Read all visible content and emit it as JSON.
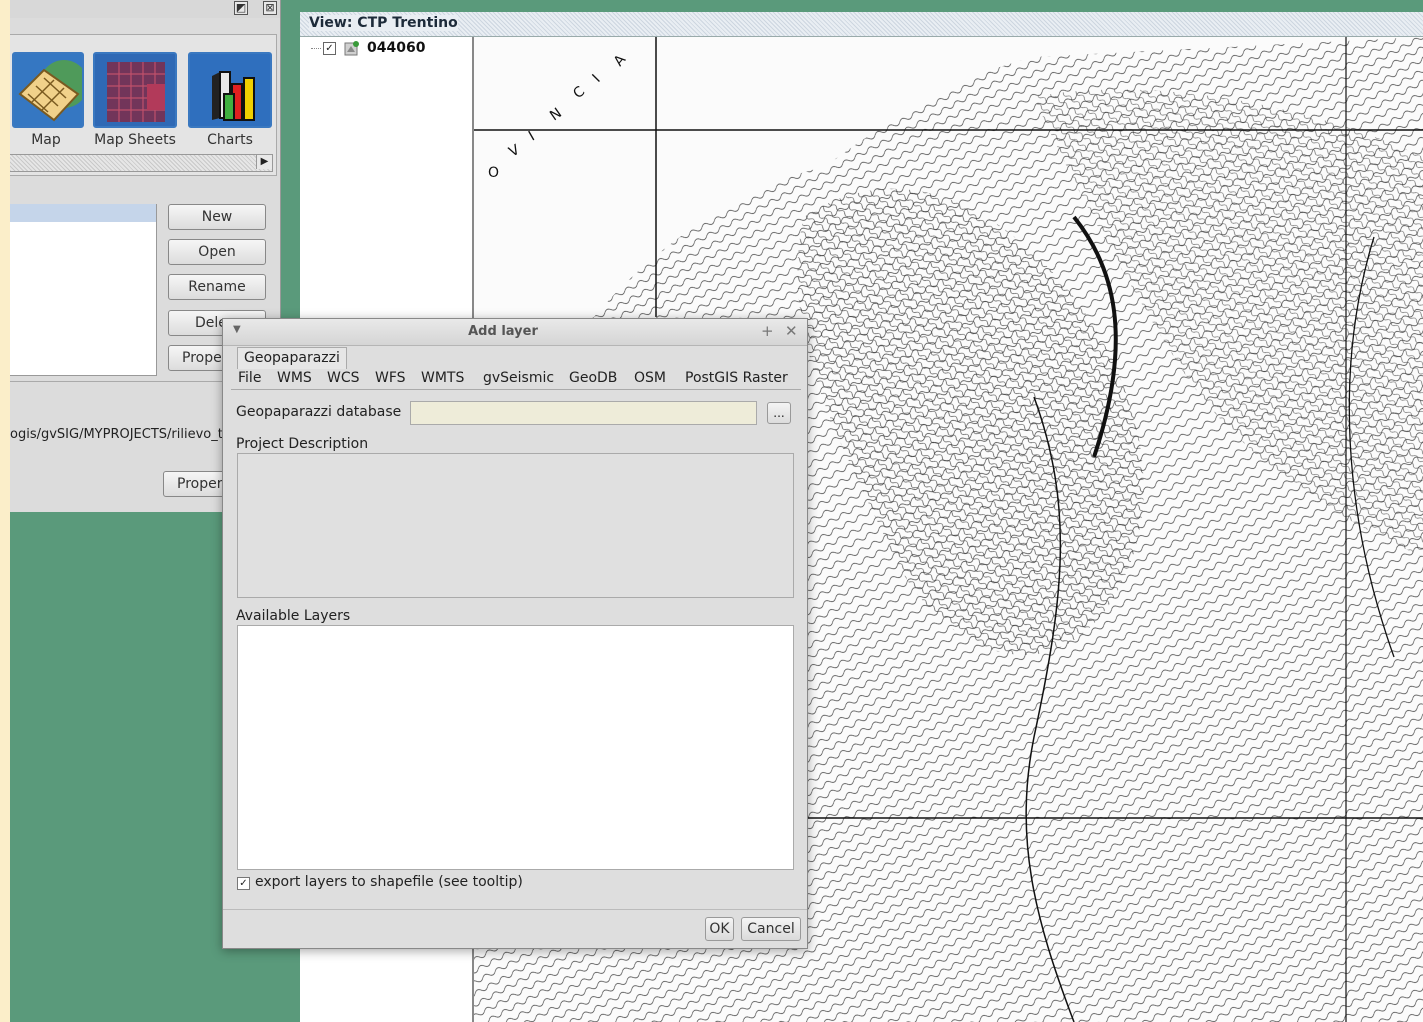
{
  "project_manager": {
    "doc_types": [
      {
        "label": "Map",
        "icon": "map-icon"
      },
      {
        "label": "Map Sheets",
        "icon": "map-sheets-icon"
      },
      {
        "label": "Charts",
        "icon": "charts-icon"
      }
    ],
    "buttons": {
      "new": "New",
      "open": "Open",
      "rename": "Rename",
      "delete": "Dele",
      "properties": "Prope"
    },
    "project_path": "ogis/gvSIG/MYPROJECTS/rilievo_t",
    "project_properties_button": "Proper"
  },
  "view": {
    "title": "View: CTP Trentino",
    "toc": {
      "layer_name": "044060",
      "checked": true
    },
    "map_text": [
      "O",
      "V",
      "I",
      "N",
      "C",
      "I",
      "A"
    ]
  },
  "dialog": {
    "title": "Add layer",
    "tabs_top": [
      "Geopaparazzi"
    ],
    "tabs": [
      "File",
      "WMS",
      "WCS",
      "WFS",
      "WMTS",
      "gvSeismic",
      "GeoDB",
      "OSM",
      "PostGIS Raster"
    ],
    "selected_tab": "Geopaparazzi",
    "db_label": "Geopaparazzi database",
    "db_value": "",
    "browse_label": "...",
    "project_description_label": "Project Description",
    "available_layers_label": "Available Layers",
    "export_label": "export layers to shapefile (see tooltip)",
    "export_checked": true,
    "ok_label": "OK",
    "cancel_label": "Cancel"
  },
  "colors": {
    "desktop_green": "#5a9a7b",
    "title_bar": "#e9eef3",
    "selection": "#c5d5ea"
  }
}
